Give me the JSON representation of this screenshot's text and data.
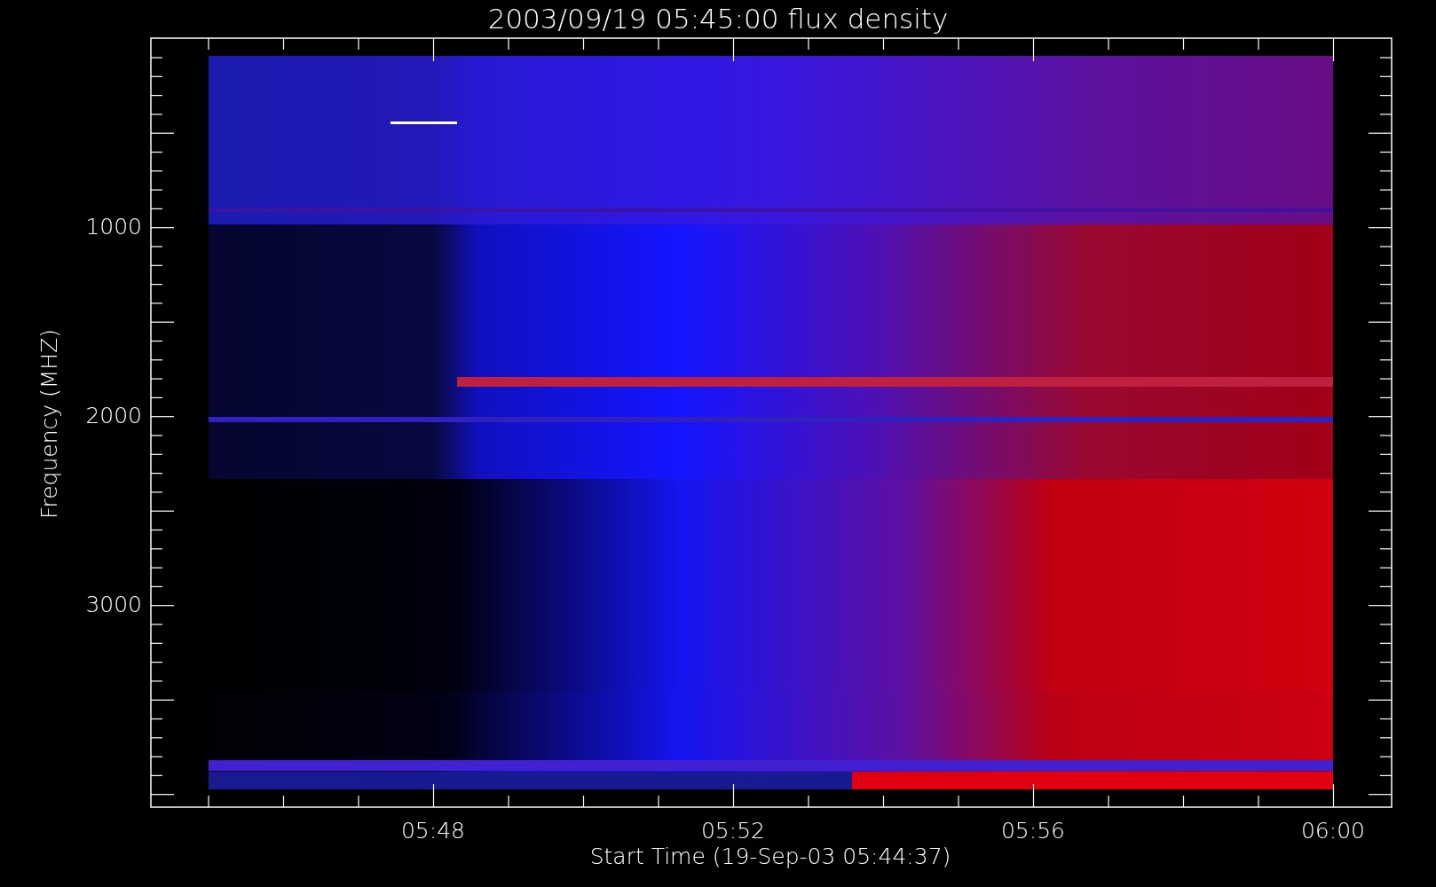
{
  "title": "2003/09/19 05:45:00 flux density",
  "y_axis": {
    "label": "Frequency (MHZ)",
    "ticks": [
      "1000",
      "2000",
      "3000"
    ]
  },
  "x_axis": {
    "label": "Start Time (19-Sep-03 05:44:37)",
    "ticks": [
      "05:48",
      "05:52",
      "05:56",
      "06:00"
    ]
  }
}
